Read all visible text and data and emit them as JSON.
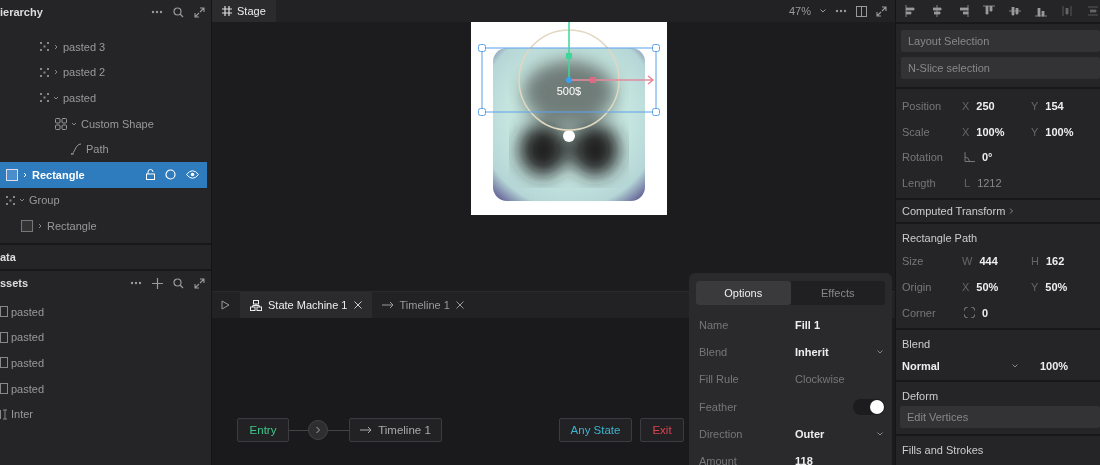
{
  "hierarchy": {
    "title": "ierarchy",
    "nested_items": [
      {
        "name": "pasted 3",
        "kind": "group",
        "expanded": false,
        "selected": false
      },
      {
        "name": "pasted 2",
        "kind": "group",
        "expanded": false,
        "selected": false
      },
      {
        "name": "pasted",
        "kind": "group",
        "expanded": true,
        "selected": false,
        "children": [
          {
            "name": "Custom Shape",
            "kind": "custom_shape",
            "expanded": true,
            "selected": false,
            "children": [
              {
                "name": "Path",
                "kind": "path",
                "selected": false
              }
            ]
          }
        ]
      }
    ],
    "items": [
      {
        "name": "Rectangle",
        "kind": "rectangle",
        "expanded": false,
        "selected": true
      },
      {
        "name": "Group",
        "kind": "group",
        "expanded": true,
        "selected": false,
        "children": [
          {
            "name": "Rectangle",
            "kind": "rectangle",
            "expanded": false,
            "selected": false
          }
        ]
      }
    ]
  },
  "data_panel": {
    "title": "ata"
  },
  "assets": {
    "title": "ssets",
    "items": [
      {
        "name": "pasted",
        "kind": "image"
      },
      {
        "name": "pasted",
        "kind": "image"
      },
      {
        "name": "pasted",
        "kind": "image"
      },
      {
        "name": "pasted",
        "kind": "image"
      },
      {
        "name": "Inter",
        "kind": "font"
      }
    ]
  },
  "stage": {
    "tab": "Stage",
    "zoom": "47%",
    "artwork_label": "500$"
  },
  "timeline": {
    "tabs": [
      {
        "label": "State Machine 1",
        "kind": "state_machine",
        "selected": true
      },
      {
        "label": "Timeline 1",
        "kind": "timeline",
        "selected": false
      }
    ],
    "nodes": [
      {
        "label": "Entry",
        "kind": "entry"
      },
      {
        "label": "Timeline 1",
        "kind": "animation"
      },
      {
        "label": "Any State",
        "kind": "any"
      },
      {
        "label": "Exit",
        "kind": "exit"
      }
    ]
  },
  "fill_popover": {
    "tabs": [
      {
        "label": "Options",
        "selected": true
      },
      {
        "label": "Effects",
        "selected": false
      }
    ],
    "rows": [
      {
        "label": "Name",
        "kind": "text",
        "value": "Fill 1"
      },
      {
        "label": "Blend",
        "kind": "select",
        "value": "Inherit"
      },
      {
        "label": "Fill Rule",
        "kind": "muted",
        "value": "Clockwise"
      },
      {
        "label": "Feather",
        "kind": "toggle",
        "on": true
      },
      {
        "label": "Direction",
        "kind": "select",
        "value": "Outer"
      },
      {
        "label": "Amount",
        "kind": "text",
        "value": "118"
      }
    ]
  },
  "inspector": {
    "buttons": [
      "Layout Selection",
      "N-Slice selection"
    ],
    "transform": [
      {
        "label": "Position",
        "fields": [
          {
            "kind": "axis",
            "axis": "X",
            "value": "250",
            "disabled": false
          },
          {
            "kind": "axis",
            "axis": "Y",
            "value": "154",
            "disabled": false
          }
        ]
      },
      {
        "label": "Scale",
        "fields": [
          {
            "kind": "axis",
            "axis": "X",
            "value": "100%",
            "disabled": false
          },
          {
            "kind": "axis",
            "axis": "Y",
            "value": "100%",
            "disabled": false
          }
        ]
      },
      {
        "label": "Rotation",
        "fields": [
          {
            "kind": "angle",
            "value": "0°",
            "disabled": false
          }
        ]
      },
      {
        "label": "Length",
        "fields": [
          {
            "kind": "axis",
            "axis": "L",
            "value": "1212",
            "disabled": true
          }
        ]
      }
    ],
    "computed_transform": "Computed Transform",
    "rectangle_path": {
      "title": "Rectangle Path",
      "rows": [
        {
          "label": "Size",
          "fields": [
            {
              "kind": "axis",
              "axis": "W",
              "value": "444",
              "disabled": false
            },
            {
              "kind": "axis",
              "axis": "H",
              "value": "162",
              "disabled": false
            }
          ]
        },
        {
          "label": "Origin",
          "fields": [
            {
              "kind": "axis",
              "axis": "X",
              "value": "50%",
              "disabled": false
            },
            {
              "kind": "axis",
              "axis": "Y",
              "value": "50%",
              "disabled": false
            }
          ]
        },
        {
          "label": "Corner",
          "fields": [
            {
              "kind": "corner",
              "value": "0",
              "disabled": false
            }
          ]
        }
      ]
    },
    "blend": {
      "title": "Blend",
      "mode": "Normal",
      "opacity": "100%"
    },
    "deform": {
      "title": "Deform",
      "button": "Edit Vertices"
    },
    "fills_title": "Fills and Strokes"
  }
}
